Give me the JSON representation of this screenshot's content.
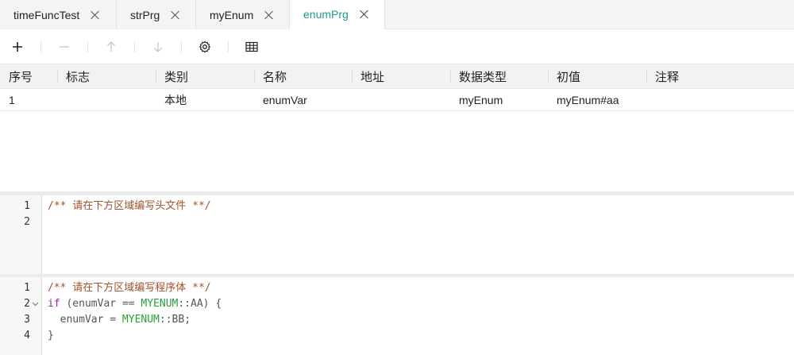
{
  "tabs": [
    {
      "label": "timeFuncTest",
      "active": false
    },
    {
      "label": "strPrg",
      "active": false
    },
    {
      "label": "myEnum",
      "active": false
    },
    {
      "label": "enumPrg",
      "active": true
    }
  ],
  "colors": {
    "accent": "#1a9a8a",
    "comment": "#a0522d",
    "keyword": "#9b1fa8",
    "enum_type": "#2a9d3b"
  },
  "toolbar": {
    "icons": [
      "plus-icon",
      "minus-icon",
      "arrow-up-icon",
      "arrow-down-icon",
      "gear-icon",
      "table-icon"
    ]
  },
  "table": {
    "headers": [
      "序号",
      "标志",
      "类别",
      "名称",
      "地址",
      "数据类型",
      "初值",
      "注释"
    ],
    "rows": [
      [
        "1",
        "",
        "本地",
        "enumVar",
        "",
        "myEnum",
        "myEnum#aa",
        ""
      ]
    ]
  },
  "header_editor": {
    "line_numbers": [
      "1",
      "2"
    ],
    "line1": "/** 请在下方区域编写头文件 **/"
  },
  "body_editor": {
    "line_numbers": [
      "1",
      "2",
      "3",
      "4"
    ],
    "line1": "/** 请在下方区域编写程序体 **/",
    "line2": {
      "kw": "if",
      "a": " (enumVar == ",
      "type": "MYENUM",
      "b": "::AA) {"
    },
    "line3": {
      "a": "  enumVar = ",
      "type": "MYENUM",
      "b": "::BB;"
    },
    "line4": "}"
  }
}
